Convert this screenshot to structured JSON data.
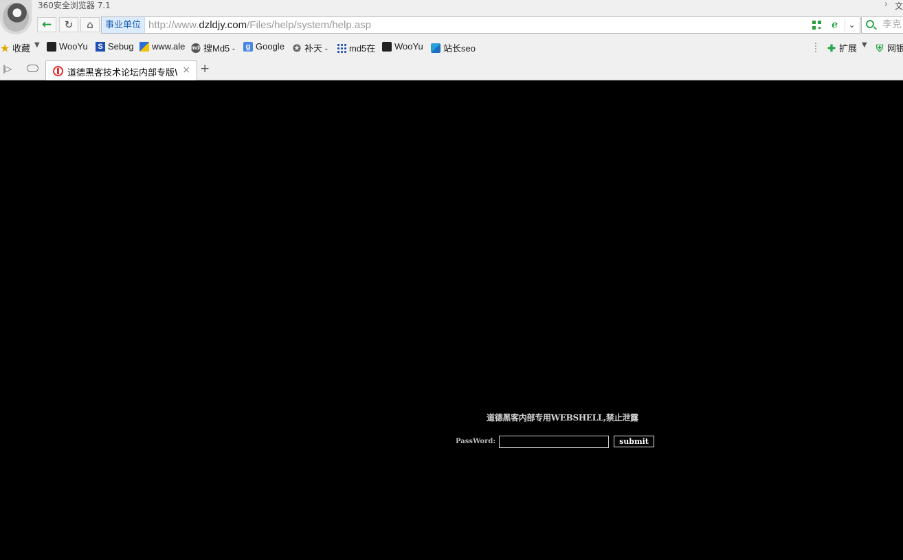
{
  "window": {
    "app_title": "360安全浏览器 7.1",
    "right_text": "文"
  },
  "nav": {
    "badge": "事业单位",
    "url_prefix": "http://www.",
    "url_domain": "dzldjy.com",
    "url_path": "/Files/help/system/help.asp",
    "search_text": "李克"
  },
  "bookmarks": {
    "favorites_label": "收藏",
    "items": [
      {
        "label": "WooYu",
        "icon": "wooyun-icon"
      },
      {
        "label": "Sebug",
        "icon": "sebug-icon"
      },
      {
        "label": "www.ale",
        "icon": "ale-icon"
      },
      {
        "label": "搜Md5 -",
        "icon": "md5-icon"
      },
      {
        "label": "Google",
        "icon": "google-icon"
      },
      {
        "label": "补天 -",
        "icon": "butian-icon"
      },
      {
        "label": "md5在",
        "icon": "grid-icon"
      },
      {
        "label": "WooYu",
        "icon": "wooyun-icon"
      },
      {
        "label": "站长seo",
        "icon": "zhanzhang-icon"
      }
    ],
    "extensions_label": "扩展",
    "bank_label": "网银"
  },
  "tab": {
    "title": "道德黑客技术论坛内部专版WEBSHELL"
  },
  "page": {
    "warning": "道德黑客内部专用WEBSHELL,禁止泄露",
    "password_label": "PassWord:",
    "password_value": "",
    "submit_label": "submit"
  },
  "colors": {
    "page_bg": "#000000",
    "accent_green": "#2aa44a"
  }
}
